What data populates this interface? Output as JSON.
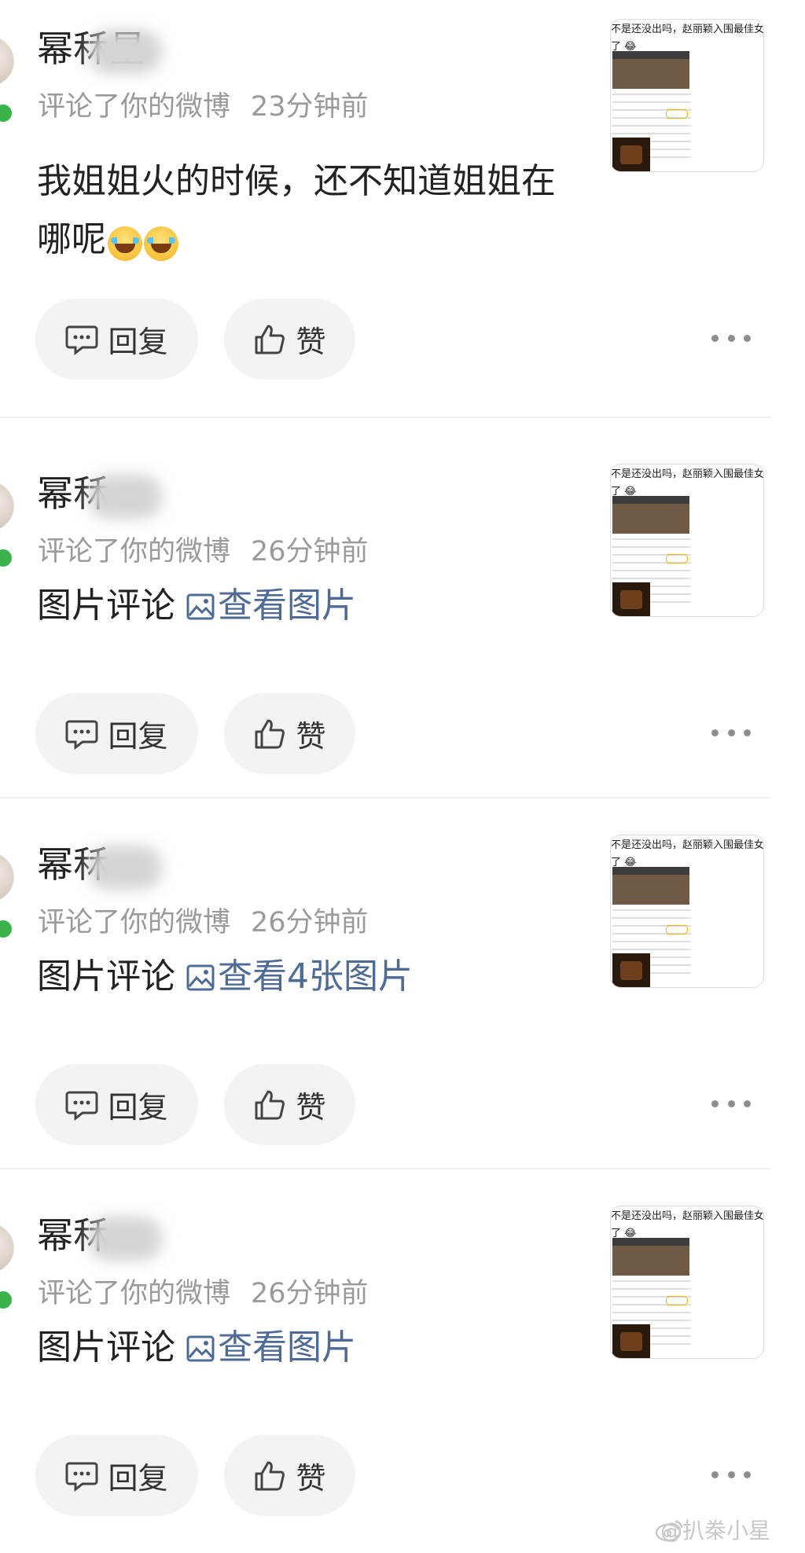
{
  "comments": [
    {
      "name": "幂秝星",
      "action": "评论了你的微博",
      "time": "23分钟前",
      "content_text": "我姐姐火的时候，还不知道姐姐在哪呢",
      "emoji": [
        "😂",
        "😂"
      ],
      "link_text": "",
      "thumbnail_text": "不是还没出吗，赵丽颖入围最佳女\n了 😂",
      "reply_label": "回复",
      "like_label": "赞"
    },
    {
      "name": "幂秝",
      "action": "评论了你的微博",
      "time": "26分钟前",
      "content_text": "图片评论",
      "emoji": [],
      "link_text": "查看图片",
      "thumbnail_text": "不是还没出吗，赵丽颖入围最佳女\n了 😂",
      "reply_label": "回复",
      "like_label": "赞"
    },
    {
      "name": "幂秝",
      "action": "评论了你的微博",
      "time": "26分钟前",
      "content_text": "图片评论",
      "emoji": [],
      "link_text": "查看4张图片",
      "thumbnail_text": "不是还没出吗，赵丽颖入围最佳女\n了 😂",
      "reply_label": "回复",
      "like_label": "赞"
    },
    {
      "name": "幂秝",
      "action": "评论了你的微博",
      "time": "26分钟前",
      "content_text": "图片评论",
      "emoji": [],
      "link_text": "查看图片",
      "thumbnail_text": "不是还没出吗，赵丽颖入围最佳女\n了 😂",
      "reply_label": "回复",
      "like_label": "赞"
    }
  ],
  "icons": {
    "reply": "comment-bubble-icon",
    "like": "thumbs-up-icon",
    "more": "more-dots-icon",
    "image": "image-icon",
    "verified": "verified-badge-icon"
  },
  "colors": {
    "link": "#4e6b95",
    "meta": "#9a9a9a",
    "button_bg": "#f3f3f3",
    "verified": "#3cb34a"
  },
  "watermark": "@扒桊小星"
}
